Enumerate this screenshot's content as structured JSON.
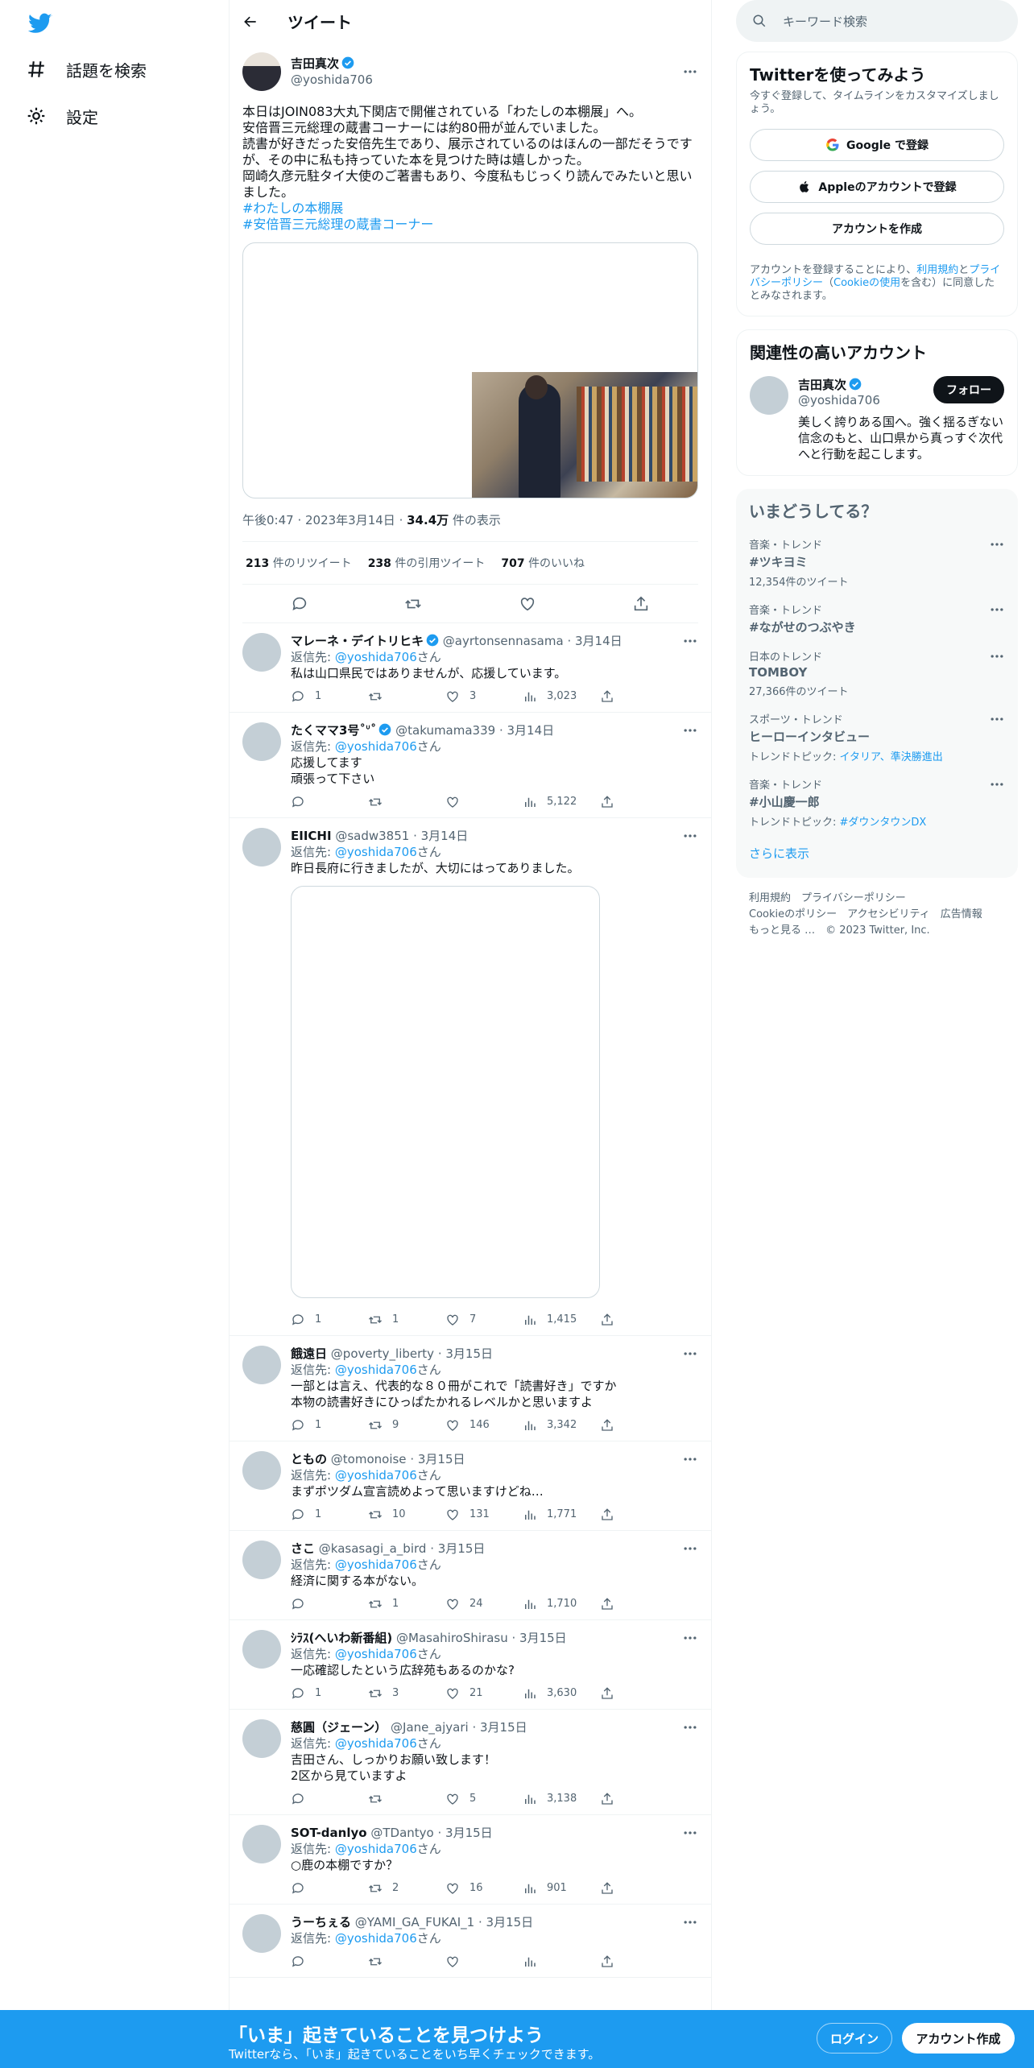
{
  "nav": {
    "explore": "話題を検索",
    "settings": "設定"
  },
  "header": {
    "title": "ツイート"
  },
  "tweet": {
    "name": "吉田真次",
    "handle": "@yoshida706",
    "text": "本日はJOIN083大丸下関店で開催されている「わたしの本棚展」へ。\n安倍晋三元総理の蔵書コーナーには約80冊が並んでいました。\n読書が好きだった安倍先生であり、展示されているのはほんの一部だそうですが、その中に私も持っていた本を見つけた時は嬉しかった。\n岡崎久彦元駐タイ大使のご著書もあり、今度私もじっくり読んでみたいと思いました。",
    "hashtags": [
      "#わたしの本棚展",
      "#安倍晋三元総理の蔵書コーナー"
    ],
    "time": "午後0:47",
    "date": "2023年3月14日",
    "views": "34.4万",
    "views_label": "件の表示",
    "retweets": "213",
    "retweets_label": "件のリツイート",
    "quotes": "238",
    "quotes_label": "件の引用ツイート",
    "likes": "707",
    "likes_label": "件のいいね"
  },
  "reply_to_label": "返信先:",
  "reply_to_handle": "@yoshida706",
  "reply_to_suffix": "さん",
  "replies": [
    {
      "name": "マレーネ・デイトリヒキ",
      "handle": "@ayrtonsennasama",
      "date": "3月14日",
      "text": "私は山口県民ではありませんが、応援しています。",
      "replies": "1",
      "retweets": "",
      "likes": "3",
      "views": "3,023"
    },
    {
      "name": "たくママ3号˚ᐡ˚",
      "handle": "@takumama339",
      "date": "3月14日",
      "text": "応援してます\n頑張って下さい",
      "replies": "",
      "retweets": "",
      "likes": "",
      "views": "5,122"
    },
    {
      "name": "EIICHI",
      "handle": "@sadw3851",
      "date": "3月14日",
      "text": "昨日長府に行きましたが、大切にはってありました。",
      "replies": "1",
      "retweets": "1",
      "likes": "7",
      "views": "1,415"
    },
    {
      "name": "餓遠日",
      "handle": "@poverty_liberty",
      "date": "3月15日",
      "text": "一部とは言え、代表的な８０冊がこれで「読書好き」ですか\n本物の読書好きにひっぱたかれるレベルかと思いますよ",
      "replies": "1",
      "retweets": "9",
      "likes": "146",
      "views": "3,342"
    },
    {
      "name": "ともの",
      "handle": "@tomonoise",
      "date": "3月15日",
      "text": "まずポツダム宣言読めよって思いますけどね…",
      "replies": "1",
      "retweets": "10",
      "likes": "131",
      "views": "1,771"
    },
    {
      "name": "さこ",
      "handle": "@kasasagi_a_bird",
      "date": "3月15日",
      "text": "経済に関する本がない。",
      "replies": "",
      "retweets": "1",
      "likes": "24",
      "views": "1,710"
    },
    {
      "name": "ｼﾗｽ(へいわ新番組)",
      "handle": "@MasahiroShirasu",
      "date": "3月15日",
      "text": "一応確認したという広辞苑もあるのかな?",
      "replies": "1",
      "retweets": "3",
      "likes": "21",
      "views": "3,630"
    },
    {
      "name": "慈圓（ジェーン）",
      "handle": "@Jane_ajyari",
      "date": "3月15日",
      "text": "吉田さん、しっかりお願い致します！\n2区から見ていますよ",
      "replies": "",
      "retweets": "",
      "likes": "5",
      "views": "3,138"
    },
    {
      "name": "SOT-danlyo",
      "handle": "@TDantyo",
      "date": "3月15日",
      "text": "○鹿の本棚ですか？",
      "replies": "",
      "retweets": "2",
      "likes": "16",
      "views": "901"
    },
    {
      "name": "うーちぇる",
      "handle": "@YAMI_GA_FUKAI_1",
      "date": "3月15日",
      "text": "",
      "replies": "",
      "retweets": "",
      "likes": "",
      "views": ""
    }
  ],
  "search": {
    "placeholder": "キーワード検索"
  },
  "signup_box": {
    "title": "Twitterを使ってみよう",
    "subtitle": "今すぐ登録して、タイムラインをカスタマイズしましょう。",
    "google": "Google で登録",
    "apple": "Appleのアカウントで登録",
    "create": "アカウントを作成",
    "terms_prefix": "アカウントを登録することにより、",
    "terms": "利用規約",
    "and": "と",
    "privacy": "プライバシーポリシー",
    "cookie_prefix": "（",
    "cookie": "Cookieの使用",
    "terms_suffix": "を含む）に同意したとみなされます。"
  },
  "related": {
    "title": "関連性の高いアカウント",
    "name": "吉田真次",
    "handle": "@yoshida706",
    "follow": "フォロー",
    "bio": "美しく誇りある国へ。強く揺るぎない信念のもと、山口県から真っすぐ次代へと行動を起こします。"
  },
  "trends": {
    "title": "いまどうしてる？",
    "items": [
      {
        "context": "音楽・トレンド",
        "name": "#ツキヨミ",
        "extra": "12,354件のツイート",
        "link": ""
      },
      {
        "context": "音楽・トレンド",
        "name": "#ながせのつぶやき",
        "extra": "",
        "link": ""
      },
      {
        "context": "日本のトレンド",
        "name": "TOMBOY",
        "extra": "27,366件のツイート",
        "link": ""
      },
      {
        "context": "スポーツ・トレンド",
        "name": "ヒーローインタビュー",
        "extra": "トレンドトピック:",
        "link": "イタリア、準決勝進出"
      },
      {
        "context": "音楽・トレンド",
        "name": "#小山慶一郎",
        "extra": "トレンドトピック:",
        "link": "#ダウンタウンDX"
      }
    ],
    "more": "さらに表示"
  },
  "footer": "利用規約　プライバシーポリシー\nCookieのポリシー　アクセシビリティ　広告情報\nもっと見る …　© 2023 Twitter, Inc.",
  "bottom": {
    "title": "「いま」起きていることを見つけよう",
    "subtitle": "Twitterなら、「いま」起きていることをいち早くチェックできます。",
    "login": "ログイン",
    "signup": "アカウント作成"
  },
  "colors": {
    "accent": "#1d9bf0",
    "text": "#0f1419",
    "muted": "#536471",
    "border": "#eff3f4"
  }
}
